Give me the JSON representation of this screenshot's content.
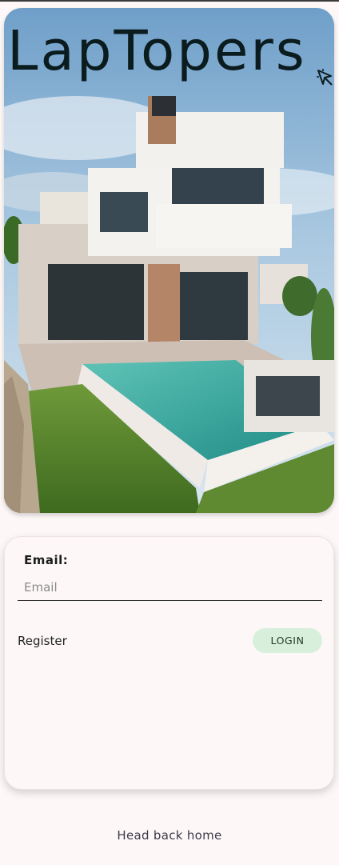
{
  "app": {
    "brand_title": "LapTopers"
  },
  "hero": {
    "image_alt": "Modern house with pool"
  },
  "login_form": {
    "email_label": "Email:",
    "email_placeholder": "Email",
    "email_value": "",
    "register_label": "Register",
    "login_label": "LOGIN"
  },
  "footer": {
    "home_link_label": "Head back home"
  },
  "colors": {
    "background": "#fdf8f7",
    "login_button": "#d8efdc",
    "brand_text": "#0b1c1f"
  }
}
